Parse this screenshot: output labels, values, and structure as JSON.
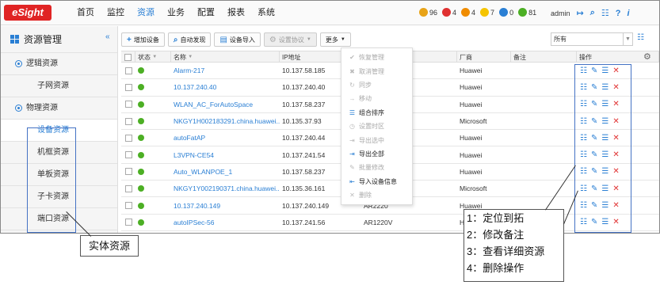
{
  "app": {
    "logo": "eSight"
  },
  "nav": {
    "items": [
      "首页",
      "监控",
      "资源",
      "业务",
      "配置",
      "报表",
      "系统"
    ],
    "active_index": 2
  },
  "alarms": [
    {
      "icon": "critical-alarm-icon",
      "count": "96",
      "color": "#e8a317"
    },
    {
      "icon": "major-alarm-icon",
      "count": "4",
      "color": "#e03131"
    },
    {
      "icon": "minor-alarm-icon",
      "count": "4",
      "color": "#f08c00"
    },
    {
      "icon": "warning-alarm-icon",
      "count": "7",
      "color": "#f5c400"
    },
    {
      "icon": "info-alarm-icon",
      "count": "0",
      "color": "#2a7fd4"
    },
    {
      "icon": "normal-status-icon",
      "count": "81",
      "color": "#4caf24"
    }
  ],
  "user": {
    "name": "admin"
  },
  "sidebar": {
    "title": "资源管理",
    "groups": [
      {
        "label": "逻辑资源",
        "items": [
          "子网资源"
        ]
      },
      {
        "label": "物理资源",
        "items": [
          "设备资源",
          "机框资源",
          "单板资源",
          "子卡资源",
          "端口资源"
        ]
      }
    ],
    "active_item": "设备资源"
  },
  "toolbar": {
    "add": "增加设备",
    "discover": "自动发现",
    "import": "设备导入",
    "protocol": "设置协议",
    "more": "更多"
  },
  "filter": {
    "value": "所有"
  },
  "table": {
    "headers": [
      "状态",
      "名称",
      "IP地址",
      "",
      "厂商",
      "备注",
      "操作"
    ],
    "rows": [
      {
        "name": "Alarm-217",
        "ip": "10.137.58.185",
        "type": "",
        "vendor": "Huawei"
      },
      {
        "name": "10.137.240.40",
        "ip": "10.137.240.40",
        "type": "",
        "vendor": "Huawei"
      },
      {
        "name": "WLAN_AC_ForAutoSpace",
        "ip": "10.137.58.237",
        "type": "",
        "vendor": "Huawei"
      },
      {
        "name": "NKGY1H002183291.china.huawei....",
        "ip": "10.135.37.93",
        "type": "wsWorkstati...",
        "vendor": "Microsoft"
      },
      {
        "name": "autoFatAP",
        "ip": "10.137.240.44",
        "type": "",
        "vendor": "Huawei"
      },
      {
        "name": "L3VPN-CE54",
        "ip": "10.137.241.54",
        "type": "",
        "vendor": "Huawei"
      },
      {
        "name": "Auto_WLANPOE_1",
        "ip": "10.137.58.237",
        "type": "",
        "vendor": "Huawei"
      },
      {
        "name": "NKGY1Y002190371.china.huawei....",
        "ip": "10.135.36.161",
        "type": "wsWorkstati...",
        "vendor": "Microsoft"
      },
      {
        "name": "10.137.240.149",
        "ip": "10.137.240.149",
        "type": "AR2220",
        "vendor": "Huawei"
      },
      {
        "name": "autoIPSec-56",
        "ip": "10.137.241.56",
        "type": "AR1220V",
        "vendor": "Hu"
      }
    ]
  },
  "more_menu": [
    {
      "label": "恢复管理",
      "icon": "restore-icon",
      "enabled": false
    },
    {
      "label": "取消管理",
      "icon": "unmanage-icon",
      "enabled": false
    },
    {
      "label": "同步",
      "icon": "sync-icon",
      "enabled": false
    },
    {
      "label": "移动",
      "icon": "move-icon",
      "enabled": false
    },
    {
      "label": "组合排序",
      "icon": "sort-icon",
      "enabled": true
    },
    {
      "label": "设置时区",
      "icon": "timezone-icon",
      "enabled": false
    },
    {
      "label": "导出选中",
      "icon": "export-selected-icon",
      "enabled": false
    },
    {
      "label": "导出全部",
      "icon": "export-all-icon",
      "enabled": true
    },
    {
      "label": "批量修改",
      "icon": "batch-edit-icon",
      "enabled": false
    },
    {
      "label": "导入设备信息",
      "icon": "import-info-icon",
      "enabled": true
    },
    {
      "label": "删除",
      "icon": "delete-icon",
      "enabled": false
    }
  ],
  "annotations": {
    "entity": "实体资源",
    "ops": [
      "1：定位到拓",
      "2：修改备注",
      "3：查看详细资源",
      "4：删除操作"
    ]
  }
}
